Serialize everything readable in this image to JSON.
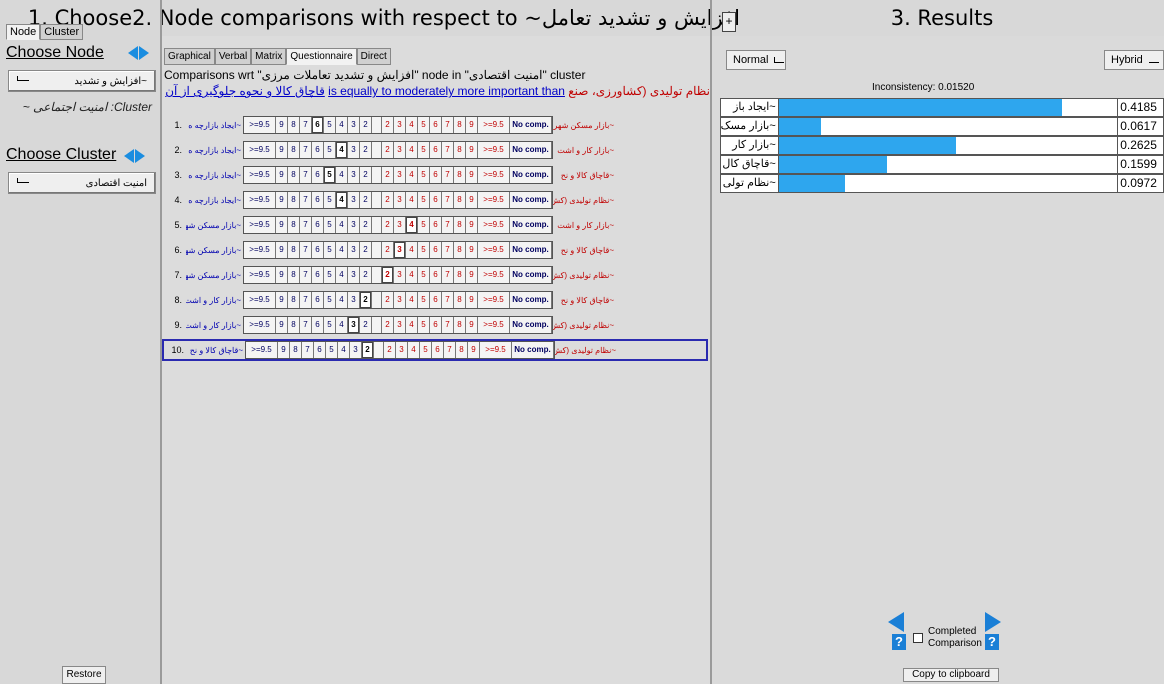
{
  "headers": {
    "choose": "1. Choose",
    "node_comparisons": "2. Node comparisons with respect to ~افزایش و تشدید تعامل",
    "results": "3. Results",
    "plus": "+"
  },
  "left": {
    "tabs": [
      "Node",
      "Cluster"
    ],
    "choose_node": "Choose Node",
    "node_value": "~افزایش و تشدید",
    "cluster_label": "Cluster: امنیت اجتماعی ~",
    "choose_cluster": "Choose Cluster",
    "cluster_value": "امنیت اقتصادی",
    "restore": "Restore"
  },
  "mid": {
    "tabs": [
      "Graphical",
      "Verbal",
      "Matrix",
      "Questionnaire",
      "Direct"
    ],
    "comparisons_wrt": "Comparisons wrt \"افزایش و تشدید تعاملات مرزی\" node in \"امنیت اقتصادی\" cluster",
    "eq_red": "نظام تولیدی (کشاورزی، صنع",
    "eq_blue": "is equally to moderately more important than",
    "eq_tail": "قاچاق کالا و نحوه جلوگیری از آن",
    "scale_left": [
      ">=9.5",
      "9",
      "8",
      "7",
      "6",
      "5",
      "4",
      "3",
      "2"
    ],
    "scale_right": [
      "2",
      "3",
      "4",
      "5",
      "6",
      "7",
      "8",
      "9",
      ">=9.5"
    ],
    "no_comp": "No comp.",
    "rows": [
      {
        "num": "1.",
        "left": "~ایجاد بازارچه ه",
        "right": "~بازار مسکن شهری"
      },
      {
        "num": "2.",
        "left": "~ایجاد بازارچه ه",
        "right": "~بازار کار و اشت"
      },
      {
        "num": "3.",
        "left": "~ایجاد بازارچه ه",
        "right": "~قاچاق کالا و نح"
      },
      {
        "num": "4.",
        "left": "~ایجاد بازارچه ه",
        "right": "~نظام تولیدی (کش"
      },
      {
        "num": "5.",
        "left": "~بازار مسکن شهری",
        "right": "~بازار کار و اشت"
      },
      {
        "num": "6.",
        "left": "~بازار مسکن شهری",
        "right": "~قاچاق کالا و نح"
      },
      {
        "num": "7.",
        "left": "~بازار مسکن شهری",
        "right": "~نظام تولیدی (کش"
      },
      {
        "num": "8.",
        "left": "~بازار کار و اشت",
        "right": "~قاچاق کالا و نح"
      },
      {
        "num": "9.",
        "left": "~بازار کار و اشت",
        "right": "~نظام تولیدی (کش"
      },
      {
        "num": "10.",
        "left": "~قاچاق کالا و نح",
        "right": "~نظام تولیدی (کش"
      }
    ]
  },
  "right": {
    "normal": "Normal",
    "hybrid": "Hybrid",
    "inconsistency": "Inconsistency: 0.01520",
    "results": [
      {
        "name": "~ایجاد باز",
        "value": "0.4185",
        "fraction": 0.4185
      },
      {
        "name": "~بازار مسک",
        "value": "0.0617",
        "fraction": 0.0617
      },
      {
        "name": "~بازار کار",
        "value": "0.2625",
        "fraction": 0.2625
      },
      {
        "name": "~قاچاق کال",
        "value": "0.1599",
        "fraction": 0.1599
      },
      {
        "name": "~نظام تولی",
        "value": "0.0972",
        "fraction": 0.0972
      }
    ],
    "completed": "Completed Comparison",
    "copy": "Copy to clipboard",
    "question_mark": "?"
  }
}
